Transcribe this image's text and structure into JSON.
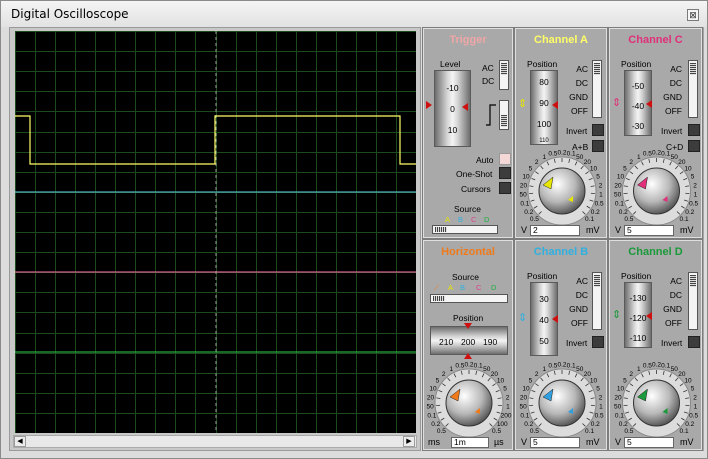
{
  "window": {
    "title": "Digital Oscilloscope",
    "close_glyph": "⊠"
  },
  "colors": {
    "chA": "#ffff66",
    "chB": "#5fd3e6",
    "chC": "#ff6fa8",
    "chD": "#30d050",
    "trigger_head": "#f0a6a6",
    "horizontal_head": "#f07a1a",
    "grid": "#1d4a1d"
  },
  "trigger": {
    "title": "Trigger",
    "level_label": "Level",
    "level_ticks": [
      "-10",
      "0",
      "10"
    ],
    "ac": "AC",
    "dc": "DC",
    "auto": "Auto",
    "one_shot": "One-Shot",
    "cursors": "Cursors",
    "source_label": "Source",
    "sources": [
      "A",
      "B",
      "C",
      "D"
    ]
  },
  "horizontal": {
    "title": "Horizontal",
    "source_label": "Source",
    "sources": [
      "A",
      "B",
      "C",
      "D"
    ],
    "position_label": "Position",
    "position_ticks": [
      "210",
      "200",
      "190"
    ],
    "dial_labels": [
      "0.5",
      "0.2",
      "0.1",
      "50",
      "20",
      "10",
      "5",
      "2",
      "1",
      "0.5",
      "0.2",
      "0.1",
      "50",
      "20",
      "10",
      "5",
      "2",
      "1",
      "200",
      "100",
      "0.5"
    ],
    "unit_left": "ms",
    "value": "1m",
    "unit_right": "µs"
  },
  "channels": {
    "a": {
      "title": "Channel A",
      "position_label": "Position",
      "ticks": [
        "80",
        "90",
        "100",
        "110"
      ],
      "ac": "AC",
      "dc": "DC",
      "gnd": "GND",
      "off": "OFF",
      "invert": "Invert",
      "combine": "A+B",
      "unit_left": "V",
      "value": "2",
      "unit_right": "mV"
    },
    "b": {
      "title": "Channel B",
      "position_label": "Position",
      "ticks": [
        "30",
        "40",
        "50"
      ],
      "ac": "AC",
      "dc": "DC",
      "gnd": "GND",
      "off": "OFF",
      "invert": "Invert",
      "unit_left": "V",
      "value": "5",
      "unit_right": "mV"
    },
    "c": {
      "title": "Channel C",
      "position_label": "Position",
      "ticks": [
        "-50",
        "-40",
        "-30"
      ],
      "ac": "AC",
      "dc": "DC",
      "gnd": "GND",
      "off": "OFF",
      "invert": "Invert",
      "combine": "C+D",
      "unit_left": "V",
      "value": "5",
      "unit_right": "mV"
    },
    "d": {
      "title": "Channel D",
      "position_label": "Position",
      "ticks": [
        "-130",
        "-120",
        "-110"
      ],
      "ac": "AC",
      "dc": "DC",
      "gnd": "GND",
      "off": "OFF",
      "invert": "Invert",
      "unit_left": "V",
      "value": "5",
      "unit_right": "mV"
    }
  },
  "volt_dial_labels": [
    "0.5",
    "0.2",
    "0.1",
    "50",
    "20",
    "10",
    "5",
    "2",
    "1",
    "0.5",
    "0.2",
    "0.1",
    "50",
    "20",
    "10",
    "5",
    "2",
    "1",
    "0.5",
    "0.2",
    "0.1"
  ],
  "scroll": {
    "left_arrow": "◀",
    "right_arrow": "▶"
  }
}
